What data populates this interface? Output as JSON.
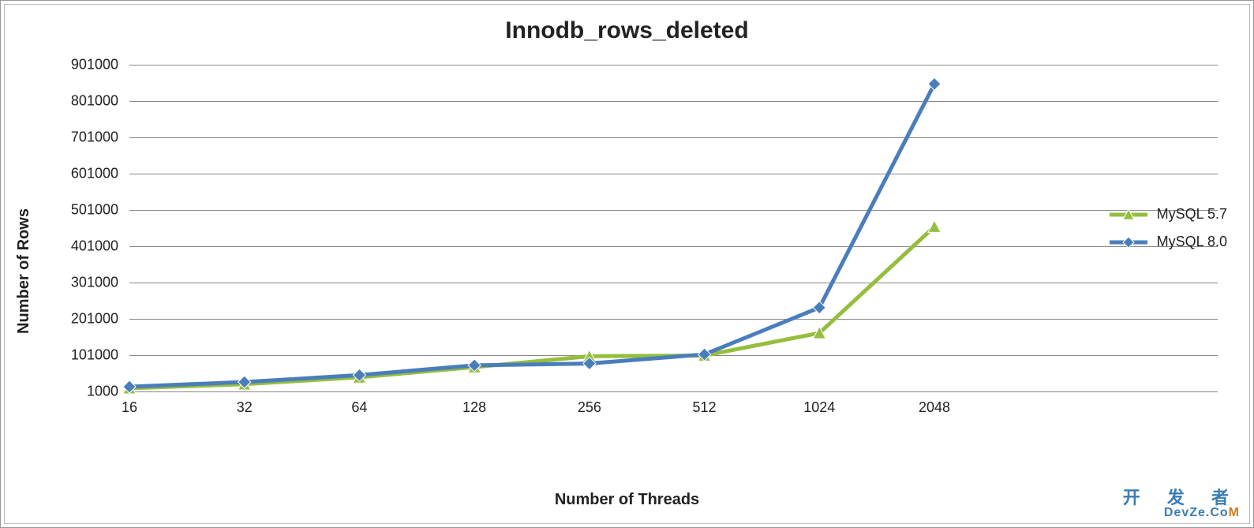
{
  "chart_data": {
    "type": "line",
    "title": "Innodb_rows_deleted",
    "xlabel": "Number of Threads",
    "ylabel": "Number of Rows",
    "categories": [
      "16",
      "32",
      "64",
      "128",
      "256",
      "512",
      "1024",
      "2048"
    ],
    "y_ticks": [
      1000,
      101000,
      201000,
      301000,
      401000,
      501000,
      601000,
      701000,
      801000,
      901000
    ],
    "ylim": [
      1000,
      901000
    ],
    "series": [
      {
        "name": "MySQL 5.7",
        "color": "#96be3e",
        "marker": "triangle",
        "values": [
          10000,
          21000,
          40000,
          68000,
          98000,
          100000,
          162000,
          455000
        ]
      },
      {
        "name": "MySQL 8.0",
        "color": "#4a7ebb",
        "marker": "diamond",
        "values": [
          14000,
          27000,
          46000,
          73000,
          78000,
          103000,
          232000,
          848000
        ]
      }
    ],
    "legend_position": "right",
    "grid": true
  },
  "watermark": {
    "line1": "开 发 者",
    "line2_pre": "DevZe.Co",
    "line2_m": "M"
  }
}
